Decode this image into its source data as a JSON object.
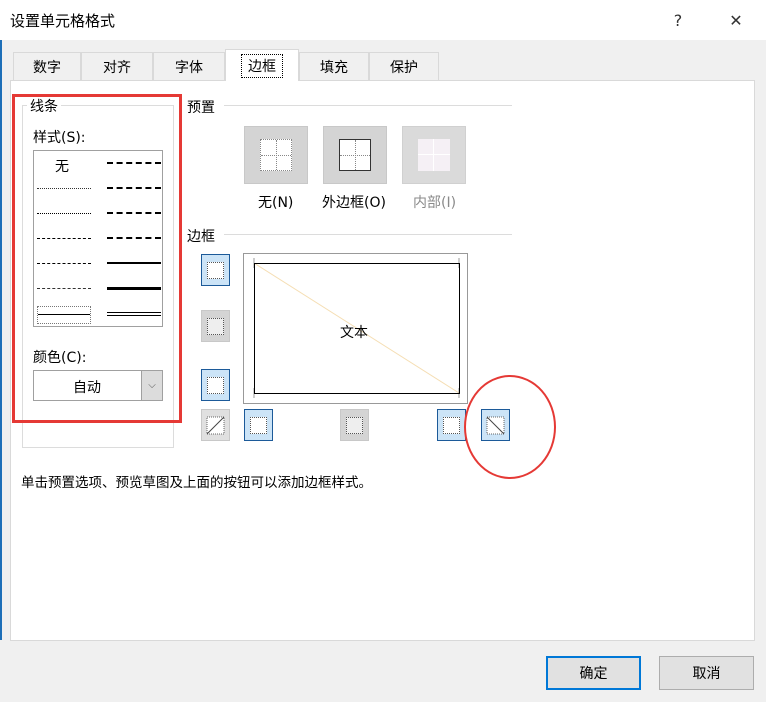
{
  "dialog": {
    "title": "设置单元格格式",
    "help_icon": "?",
    "close_icon": "✕"
  },
  "tabs": [
    {
      "label": "数字"
    },
    {
      "label": "对齐"
    },
    {
      "label": "字体"
    },
    {
      "label": "边框"
    },
    {
      "label": "填充"
    },
    {
      "label": "保护"
    }
  ],
  "line": {
    "group_label": "线条",
    "style_label": "样式(S):",
    "none_label": "无",
    "color_label": "颜色(C):",
    "color_value": "自动"
  },
  "presets": {
    "label": "预置",
    "items": [
      {
        "label": "无(N)"
      },
      {
        "label": "外边框(O)"
      },
      {
        "label": "内部(I)"
      }
    ]
  },
  "border": {
    "label": "边框",
    "preview_text": "文本"
  },
  "hint": "单击预置选项、预览草图及上面的按钮可以添加边框样式。",
  "buttons": {
    "ok": "确定",
    "cancel": "取消"
  },
  "colors": {
    "annotation": "#e53935",
    "accent": "#0078d7"
  }
}
